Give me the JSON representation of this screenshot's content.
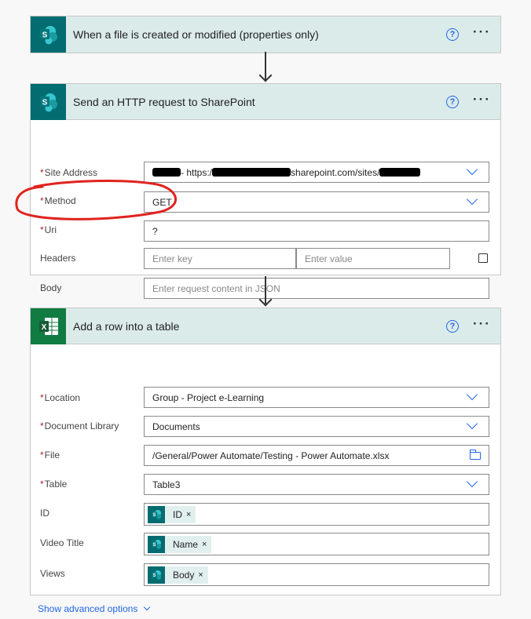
{
  "trigger": {
    "title": "When a file is created or modified (properties only)",
    "help": "?",
    "more": "···"
  },
  "http_action": {
    "title": "Send an HTTP request to SharePoint",
    "help": "?",
    "more": "···",
    "fields": {
      "site_address_label": "Site Address",
      "site_address_value_a": "- https:/",
      "site_address_value_b": "sharepoint.com/sites/",
      "method_label": "Method",
      "method_value": "GET",
      "uri_label": "Uri",
      "uri_value": "?",
      "headers_label": "Headers",
      "headers_key_placeholder": "Enter key",
      "headers_value_placeholder": "Enter value",
      "body_label": "Body",
      "body_placeholder": "Enter request content in JSON"
    }
  },
  "excel_action": {
    "title": "Add a row into a table",
    "help": "?",
    "more": "···",
    "fields": {
      "location_label": "Location",
      "location_value": "Group - Project e-Learning",
      "library_label": "Document Library",
      "library_value": "Documents",
      "file_label": "File",
      "file_value": "/General/Power Automate/Testing - Power Automate.xlsx",
      "table_label": "Table",
      "table_value": "Table3",
      "id_label": "ID",
      "id_token": "ID",
      "video_title_label": "Video Title",
      "video_title_token": "Name",
      "views_label": "Views",
      "views_token": "Body"
    },
    "advanced_link": "Show advanced options"
  },
  "req_mark": "*",
  "token_remove": "×",
  "annotation_color": "#e0231e"
}
